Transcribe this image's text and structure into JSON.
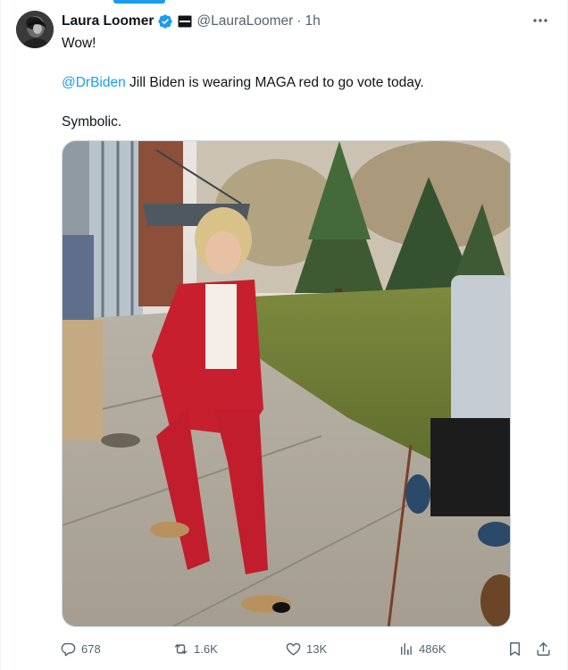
{
  "tweet": {
    "author": {
      "display_name": "Laura Loomer",
      "handle": "@LauraLoomer",
      "verified": true,
      "affiliation_badge": "flag-badge"
    },
    "time": "1h",
    "separator": "·",
    "text": {
      "line1": "Wow!",
      "mention": "@DrBiden",
      "line2_rest": " Jill Biden is wearing MAGA red to go vote today.",
      "line3": "Symbolic."
    },
    "media": {
      "description_icon": "photo"
    },
    "actions": {
      "replies": "678",
      "reposts": "1.6K",
      "likes": "13K",
      "views": "486K"
    }
  },
  "colors": {
    "accent": "#1d9bf0",
    "text": "#0f1419",
    "muted": "#536471",
    "border": "#cfd9de"
  }
}
